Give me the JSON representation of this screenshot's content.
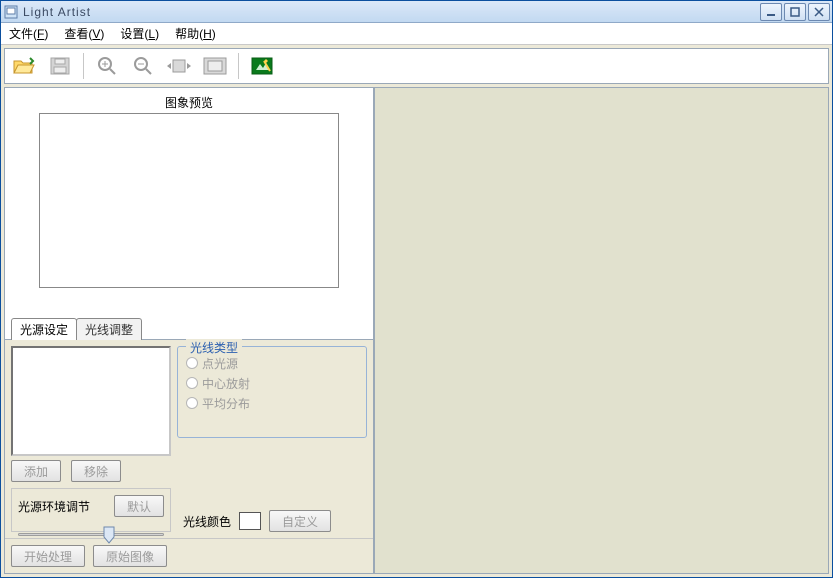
{
  "window": {
    "title": "Light Artist"
  },
  "menu": {
    "file": {
      "label": "文件",
      "accel": "F"
    },
    "view": {
      "label": "查看",
      "accel": "V"
    },
    "settings": {
      "label": "设置",
      "accel": "L"
    },
    "help": {
      "label": "帮助",
      "accel": "H"
    }
  },
  "preview": {
    "label": "图象预览"
  },
  "tabs": {
    "light_source": "光源设定",
    "ray_adjust": "光线调整"
  },
  "buttons": {
    "add": "添加",
    "remove": "移除",
    "default": "默认",
    "custom": "自定义",
    "start": "开始处理",
    "original": "原始图像"
  },
  "ray_type": {
    "legend": "光线类型",
    "point": "点光源",
    "center": "中心放射",
    "even": "平均分布"
  },
  "env": {
    "label": "光源环境调节"
  },
  "color": {
    "label": "光线颜色"
  }
}
